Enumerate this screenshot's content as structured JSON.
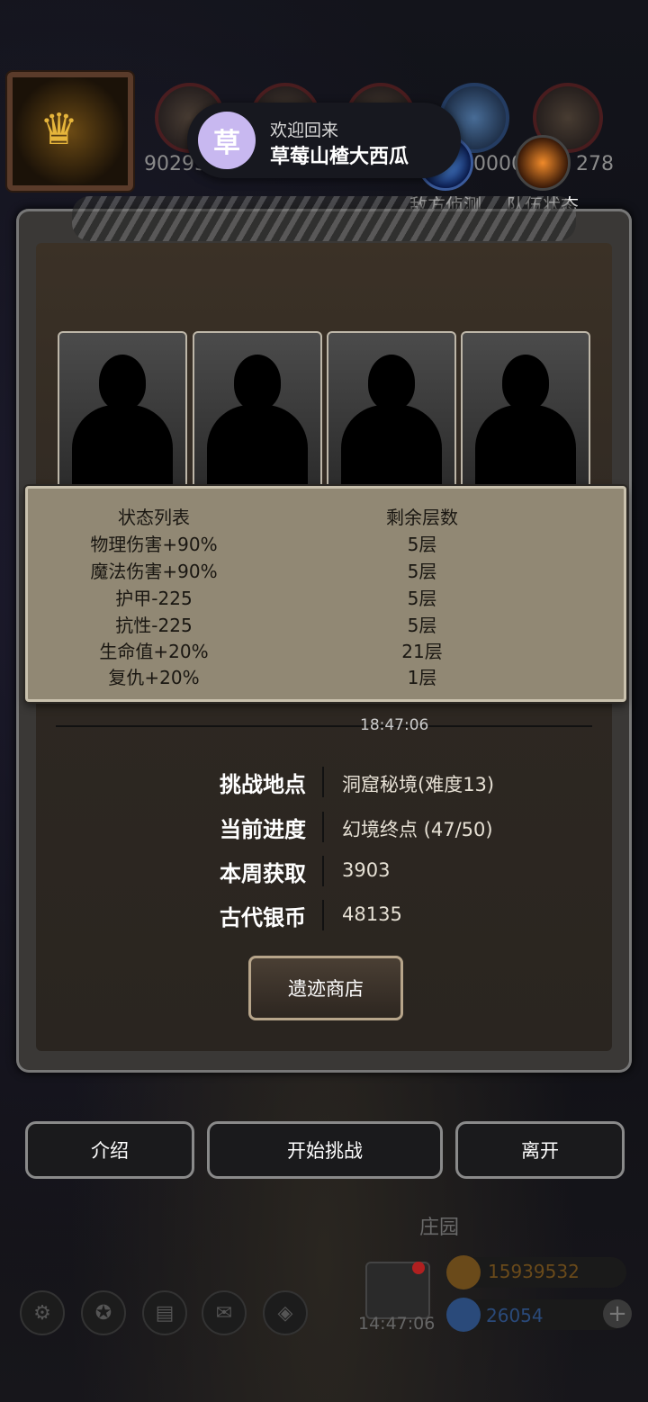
{
  "top": {
    "left_number": "90293",
    "right_numbers": [
      "0000",
      "278"
    ],
    "buttons": [
      {
        "label": "敌方侦测",
        "icon": "scout-icon"
      },
      {
        "label": "队伍状态",
        "icon": "flame-icon"
      }
    ]
  },
  "toast": {
    "avatar_char": "草",
    "welcome": "欢迎回来",
    "username": "草莓山楂大西瓜"
  },
  "status": {
    "header": [
      "状态列表",
      "剩余层数"
    ],
    "rows": [
      {
        "name": "物理伤害+90%",
        "layers": "5层"
      },
      {
        "name": "魔法伤害+90%",
        "layers": "5层"
      },
      {
        "name": "护甲-225",
        "layers": "5层"
      },
      {
        "name": "抗性-225",
        "layers": "5层"
      },
      {
        "name": "生命值+20%",
        "layers": "21层"
      },
      {
        "name": "复仇+20%",
        "layers": "1层"
      }
    ]
  },
  "panel": {
    "time": "18:47:06",
    "info": [
      {
        "label": "挑战地点",
        "value": "洞窟秘境(难度13)"
      },
      {
        "label": "当前进度",
        "value": "幻境终点 (47/50)"
      },
      {
        "label": "本周获取",
        "value": "3903"
      },
      {
        "label": "古代银币",
        "value": "48135"
      }
    ],
    "shop_button": "遗迹商店"
  },
  "actions": {
    "intro": "介绍",
    "start": "开始挑战",
    "leave": "离开"
  },
  "hud": {
    "title": "庄园",
    "time": "14:47:06",
    "gold": "15939532",
    "gems": "26054",
    "colors": {
      "gold": "#6a4a1a",
      "gem": "#2a4a7a"
    }
  }
}
